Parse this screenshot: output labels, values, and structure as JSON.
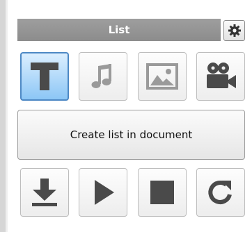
{
  "panel": {
    "title": "List",
    "settings_icon": "gear-icon"
  },
  "media_types": [
    {
      "name": "text",
      "icon": "text-t-icon",
      "selected": true
    },
    {
      "name": "audio",
      "icon": "music-note-icon",
      "selected": false
    },
    {
      "name": "image",
      "icon": "image-icon",
      "selected": false
    },
    {
      "name": "video",
      "icon": "video-camera-icon",
      "selected": false
    }
  ],
  "create_button": {
    "label": "Create list in document"
  },
  "controls": [
    {
      "name": "download",
      "icon": "download-icon"
    },
    {
      "name": "play",
      "icon": "play-icon"
    },
    {
      "name": "stop",
      "icon": "stop-icon"
    },
    {
      "name": "refresh",
      "icon": "refresh-icon"
    }
  ],
  "colors": {
    "header_bg": "#959595",
    "selected_tile": "#8cc6f5",
    "icon_dark": "#4a4a4a",
    "icon_light": "#9a9a9a"
  }
}
